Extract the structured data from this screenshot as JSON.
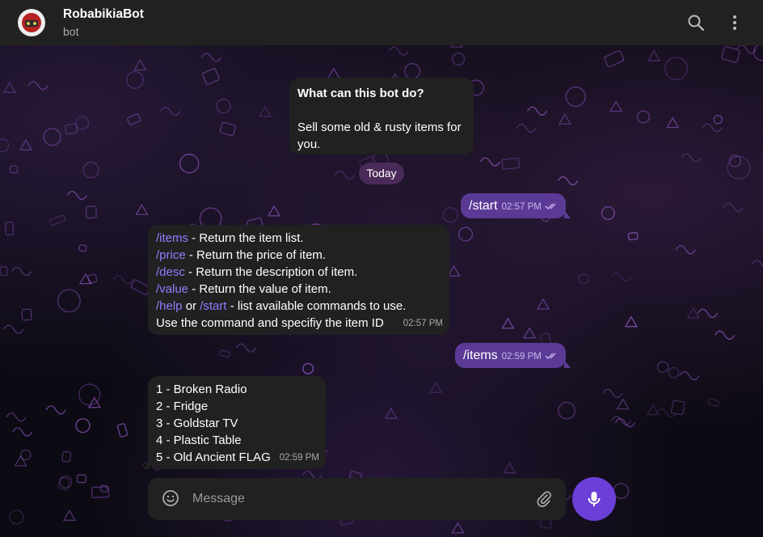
{
  "header": {
    "bot_name": "RobabikiaBot",
    "status": "bot",
    "search_icon": "search-icon",
    "menu_icon": "more-vertical-icon"
  },
  "info_card": {
    "title": "What can this bot do?",
    "body": "Sell some old & rusty items for you."
  },
  "date_separator": "Today",
  "messages": {
    "start": {
      "text": "/start",
      "time": "02:57 PM",
      "status": "read"
    },
    "help": {
      "lines": [
        {
          "cmd": "/items",
          "rest": " - Return the item list."
        },
        {
          "cmd": "/price",
          "rest": " - Return the price of item."
        },
        {
          "cmd": "/desc",
          "rest": " - Return the description of item."
        },
        {
          "cmd": "/value",
          "rest": " - Return the value of item."
        },
        {
          "cmd": "/help",
          "mid": " or ",
          "cmd2": "/start",
          "rest": " - list available commands to use."
        }
      ],
      "last_line": "Use the command and specifiy the item ID",
      "time": "02:57 PM"
    },
    "items_out": {
      "text": "/items",
      "time": "02:59 PM",
      "status": "read"
    },
    "list": {
      "lines": [
        "1 - Broken Radio",
        "2 - Fridge",
        "3 - Goldstar TV",
        "4 - Plastic Table",
        "5 - Old Ancient FLAG"
      ],
      "time": "02:59 PM"
    }
  },
  "composer": {
    "placeholder": "Message",
    "emoji_icon": "smile-icon",
    "attach_icon": "paperclip-icon",
    "mic_icon": "microphone-icon"
  },
  "colors": {
    "outgoing_bubble": "#5b3a96",
    "incoming_bubble": "#212121",
    "command_link": "#8e7dff",
    "mic_button": "#6c3fd8",
    "date_chip": "#4a2a58"
  }
}
